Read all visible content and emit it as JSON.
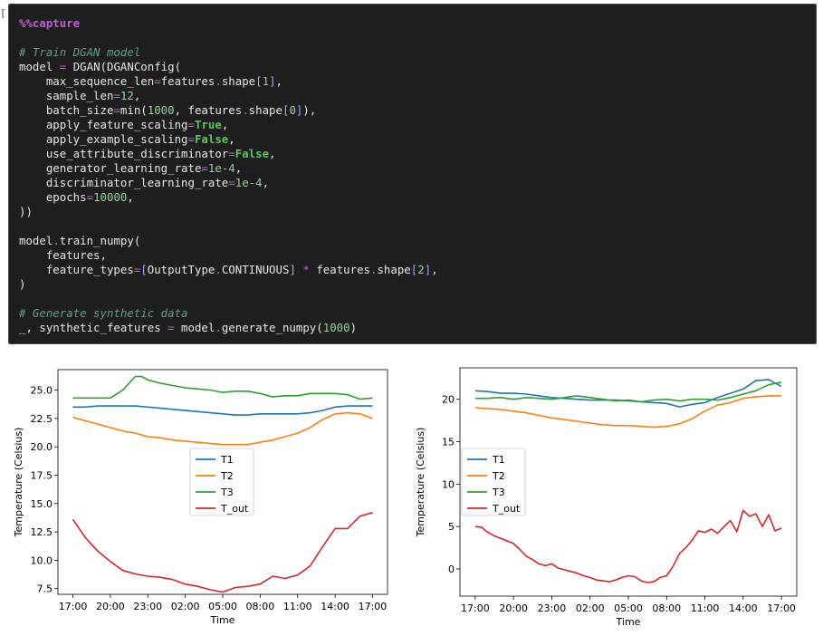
{
  "cell": {
    "prompt": "[",
    "code_lines": [
      [
        {
          "t": "%%capture",
          "c": "mg"
        }
      ],
      [],
      [
        {
          "t": "# Train DGAN model",
          "c": "cm"
        }
      ],
      [
        {
          "t": "model "
        },
        {
          "t": "=",
          "c": "eq"
        },
        {
          "t": " DGAN(DGANConfig("
        }
      ],
      [
        {
          "t": "    max_sequence_len"
        },
        {
          "t": "=",
          "c": "eq"
        },
        {
          "t": "features"
        },
        {
          "t": ".",
          "c": "op"
        },
        {
          "t": "shape"
        },
        {
          "t": "[",
          "c": "br"
        },
        {
          "t": "1",
          "c": "num"
        },
        {
          "t": "]",
          "c": "br"
        },
        {
          "t": ","
        }
      ],
      [
        {
          "t": "    sample_len"
        },
        {
          "t": "=",
          "c": "eq"
        },
        {
          "t": "12",
          "c": "num"
        },
        {
          "t": ","
        }
      ],
      [
        {
          "t": "    batch_size"
        },
        {
          "t": "=",
          "c": "eq"
        },
        {
          "t": "min("
        },
        {
          "t": "1000",
          "c": "num"
        },
        {
          "t": ", features"
        },
        {
          "t": ".",
          "c": "op"
        },
        {
          "t": "shape"
        },
        {
          "t": "[",
          "c": "br"
        },
        {
          "t": "0",
          "c": "num"
        },
        {
          "t": "]",
          "c": "br"
        },
        {
          "t": "),"
        }
      ],
      [
        {
          "t": "    apply_feature_scaling"
        },
        {
          "t": "=",
          "c": "eq"
        },
        {
          "t": "True",
          "c": "kw"
        },
        {
          "t": ","
        }
      ],
      [
        {
          "t": "    apply_example_scaling"
        },
        {
          "t": "=",
          "c": "eq"
        },
        {
          "t": "False",
          "c": "kw"
        },
        {
          "t": ","
        }
      ],
      [
        {
          "t": "    use_attribute_discriminator"
        },
        {
          "t": "=",
          "c": "eq"
        },
        {
          "t": "False",
          "c": "kw"
        },
        {
          "t": ","
        }
      ],
      [
        {
          "t": "    generator_learning_rate"
        },
        {
          "t": "=",
          "c": "eq"
        },
        {
          "t": "1e-4",
          "c": "num"
        },
        {
          "t": ","
        }
      ],
      [
        {
          "t": "    discriminator_learning_rate"
        },
        {
          "t": "=",
          "c": "eq"
        },
        {
          "t": "1e-4",
          "c": "num"
        },
        {
          "t": ","
        }
      ],
      [
        {
          "t": "    epochs"
        },
        {
          "t": "=",
          "c": "eq"
        },
        {
          "t": "10000",
          "c": "num"
        },
        {
          "t": ","
        }
      ],
      [
        {
          "t": "))"
        }
      ],
      [],
      [
        {
          "t": "model"
        },
        {
          "t": ".",
          "c": "op"
        },
        {
          "t": "train_numpy("
        }
      ],
      [
        {
          "t": "    features,"
        }
      ],
      [
        {
          "t": "    feature_types"
        },
        {
          "t": "=",
          "c": "eq"
        },
        {
          "t": "[",
          "c": "br"
        },
        {
          "t": "OutputType"
        },
        {
          "t": ".",
          "c": "op"
        },
        {
          "t": "CONTINUOUS"
        },
        {
          "t": "]",
          "c": "br"
        },
        {
          "t": " "
        },
        {
          "t": "*",
          "c": "op"
        },
        {
          "t": " features"
        },
        {
          "t": ".",
          "c": "op"
        },
        {
          "t": "shape"
        },
        {
          "t": "[",
          "c": "br"
        },
        {
          "t": "2",
          "c": "num"
        },
        {
          "t": "]",
          "c": "br"
        },
        {
          "t": ","
        }
      ],
      [
        {
          "t": ")"
        }
      ],
      [],
      [
        {
          "t": "# Generate synthetic data",
          "c": "cm"
        }
      ],
      [
        {
          "t": "_, synthetic_features "
        },
        {
          "t": "=",
          "c": "eq"
        },
        {
          "t": " model"
        },
        {
          "t": ".",
          "c": "op"
        },
        {
          "t": "generate_numpy("
        },
        {
          "t": "1000",
          "c": "num"
        },
        {
          "t": ")"
        }
      ]
    ]
  },
  "colors": {
    "T1": "#1f77b4",
    "T2": "#ff7f0e",
    "T3": "#2ca02c",
    "T_out": "#d62728"
  },
  "chart_data": [
    {
      "type": "line",
      "xlabel": "Time",
      "ylabel": "Temperature (Celsius)",
      "ylim": [
        7.0,
        26.8
      ],
      "yticks": [
        "7.5",
        "10.0",
        "12.5",
        "15.0",
        "17.5",
        "20.0",
        "22.5",
        "25.0"
      ],
      "ytick_values": [
        7.5,
        10,
        12.5,
        15,
        17.5,
        20,
        22.5,
        25
      ],
      "xticks": [
        "17:00",
        "20:00",
        "23:00",
        "02:00",
        "05:00",
        "08:00",
        "11:00",
        "14:00",
        "17:00"
      ],
      "xtick_values": [
        0,
        3,
        6,
        9,
        12,
        15,
        18,
        21,
        24
      ],
      "xlim": [
        -1.2,
        25.2
      ],
      "legend": {
        "position": "center",
        "entries": [
          "T1",
          "T2",
          "T3",
          "T_out"
        ]
      },
      "series": [
        {
          "name": "T1",
          "x": [
            0,
            1,
            2,
            3,
            4,
            5,
            6,
            7,
            8,
            9,
            10,
            11,
            12,
            13,
            14,
            15,
            16,
            17,
            18,
            19,
            20,
            21,
            22,
            23,
            24
          ],
          "values": [
            23.5,
            23.5,
            23.6,
            23.6,
            23.6,
            23.6,
            23.5,
            23.4,
            23.3,
            23.2,
            23.1,
            23.0,
            22.9,
            22.8,
            22.8,
            22.9,
            22.9,
            22.9,
            22.9,
            23.0,
            23.2,
            23.5,
            23.6,
            23.6,
            23.6
          ]
        },
        {
          "name": "T2",
          "x": [
            0,
            1,
            2,
            3,
            4,
            5,
            6,
            7,
            8,
            9,
            10,
            11,
            12,
            13,
            14,
            15,
            16,
            17,
            18,
            19,
            20,
            21,
            22,
            23,
            24
          ],
          "values": [
            22.6,
            22.3,
            22.0,
            21.7,
            21.4,
            21.2,
            20.9,
            20.8,
            20.6,
            20.5,
            20.4,
            20.3,
            20.2,
            20.2,
            20.2,
            20.4,
            20.6,
            20.9,
            21.2,
            21.7,
            22.4,
            22.9,
            23.0,
            22.9,
            22.5
          ]
        },
        {
          "name": "T3",
          "x": [
            0,
            1,
            2,
            3,
            4,
            5,
            5.5,
            6,
            7,
            8,
            9,
            10,
            11,
            12,
            13,
            14,
            15,
            16,
            17,
            18,
            19,
            20,
            21,
            22,
            23,
            24
          ],
          "values": [
            24.3,
            24.3,
            24.3,
            24.3,
            25.0,
            26.2,
            26.2,
            25.9,
            25.6,
            25.4,
            25.2,
            25.1,
            25.0,
            24.8,
            24.9,
            24.9,
            24.7,
            24.4,
            24.5,
            24.5,
            24.7,
            24.7,
            24.7,
            24.6,
            24.2,
            24.3
          ]
        },
        {
          "name": "T_out",
          "x": [
            0,
            1,
            2,
            3,
            4,
            5,
            6,
            7,
            8,
            9,
            10,
            11,
            12,
            13,
            14,
            15,
            16,
            17,
            18,
            19,
            20,
            21,
            22,
            23,
            24
          ],
          "values": [
            13.6,
            12.0,
            10.8,
            9.9,
            9.1,
            8.8,
            8.6,
            8.5,
            8.3,
            7.9,
            7.7,
            7.4,
            7.2,
            7.6,
            7.7,
            7.9,
            8.6,
            8.4,
            8.7,
            9.5,
            11.2,
            12.8,
            12.8,
            13.9,
            14.2
          ]
        }
      ]
    },
    {
      "type": "line",
      "xlabel": "Time",
      "ylabel": "Temperature (Celsius)",
      "ylim": [
        -3.2,
        23.7
      ],
      "yticks": [
        "0",
        "5",
        "10",
        "15",
        "20"
      ],
      "ytick_values": [
        0,
        5,
        10,
        15,
        20
      ],
      "xticks": [
        "17:00",
        "20:00",
        "23:00",
        "02:00",
        "05:00",
        "08:00",
        "11:00",
        "14:00",
        "17:00"
      ],
      "xtick_values": [
        0,
        3,
        6,
        9,
        12,
        15,
        18,
        21,
        24
      ],
      "xlim": [
        -1.2,
        25.2
      ],
      "legend": {
        "position": "center-left",
        "entries": [
          "T1",
          "T2",
          "T3",
          "T_out"
        ]
      },
      "series": [
        {
          "name": "T1",
          "x": [
            0,
            1,
            2,
            3,
            4,
            5,
            6,
            7,
            8,
            9,
            10,
            11,
            12,
            13,
            14,
            15,
            16,
            17,
            18,
            19,
            20,
            21,
            22,
            23,
            24
          ],
          "values": [
            21.0,
            20.9,
            20.7,
            20.7,
            20.6,
            20.4,
            20.2,
            20.1,
            20.0,
            19.9,
            19.9,
            19.9,
            19.8,
            19.7,
            19.6,
            19.5,
            19.1,
            19.4,
            19.6,
            20.2,
            20.7,
            21.2,
            22.2,
            22.3,
            21.5
          ]
        },
        {
          "name": "T2",
          "x": [
            0,
            1,
            2,
            3,
            4,
            5,
            6,
            7,
            8,
            9,
            10,
            11,
            12,
            13,
            14,
            15,
            16,
            17,
            18,
            19,
            20,
            21,
            22,
            23,
            24
          ],
          "values": [
            19.0,
            18.9,
            18.8,
            18.6,
            18.4,
            18.1,
            17.8,
            17.6,
            17.4,
            17.2,
            17.0,
            16.9,
            16.9,
            16.8,
            16.7,
            16.8,
            17.1,
            17.7,
            18.6,
            19.3,
            19.6,
            20.1,
            20.3,
            20.4,
            20.4
          ]
        },
        {
          "name": "T3",
          "x": [
            0,
            1,
            2,
            3,
            4,
            5,
            6,
            7,
            8,
            9,
            10,
            11,
            12,
            13,
            14,
            15,
            16,
            17,
            18,
            19,
            20,
            21,
            22,
            23,
            24
          ],
          "values": [
            20.1,
            20.1,
            20.2,
            20.0,
            20.2,
            20.1,
            20.0,
            20.2,
            20.4,
            20.2,
            20.0,
            19.8,
            19.9,
            19.7,
            19.9,
            20.0,
            19.8,
            20.0,
            20.0,
            19.9,
            20.2,
            20.6,
            21.0,
            21.7,
            22.0
          ]
        },
        {
          "name": "T_out",
          "x": [
            0,
            0.5,
            1,
            1.5,
            2,
            2.5,
            3,
            3.5,
            4,
            4.5,
            5,
            5.5,
            6,
            6.5,
            7,
            7.5,
            8,
            8.5,
            9,
            9.5,
            10,
            10.5,
            11,
            11.5,
            12,
            12.5,
            13,
            13.5,
            14,
            14.5,
            15,
            15.5,
            16,
            16.5,
            17,
            17.5,
            18,
            18.5,
            19,
            19.5,
            20,
            20.5,
            21,
            21.5,
            22,
            22.5,
            23,
            23.5,
            24
          ],
          "values": [
            5.0,
            4.9,
            4.3,
            3.9,
            3.6,
            3.3,
            3.0,
            2.3,
            1.5,
            1.1,
            0.6,
            0.4,
            0.6,
            0.1,
            -0.1,
            -0.3,
            -0.5,
            -0.8,
            -1.0,
            -1.3,
            -1.4,
            -1.5,
            -1.3,
            -1.0,
            -0.8,
            -0.9,
            -1.4,
            -1.6,
            -1.5,
            -1.0,
            -0.8,
            0.3,
            1.8,
            2.5,
            3.4,
            4.5,
            4.3,
            4.7,
            4.2,
            5.0,
            5.7,
            4.4,
            6.9,
            6.2,
            6.5,
            5.0,
            6.4,
            4.5,
            4.8
          ]
        }
      ]
    }
  ]
}
